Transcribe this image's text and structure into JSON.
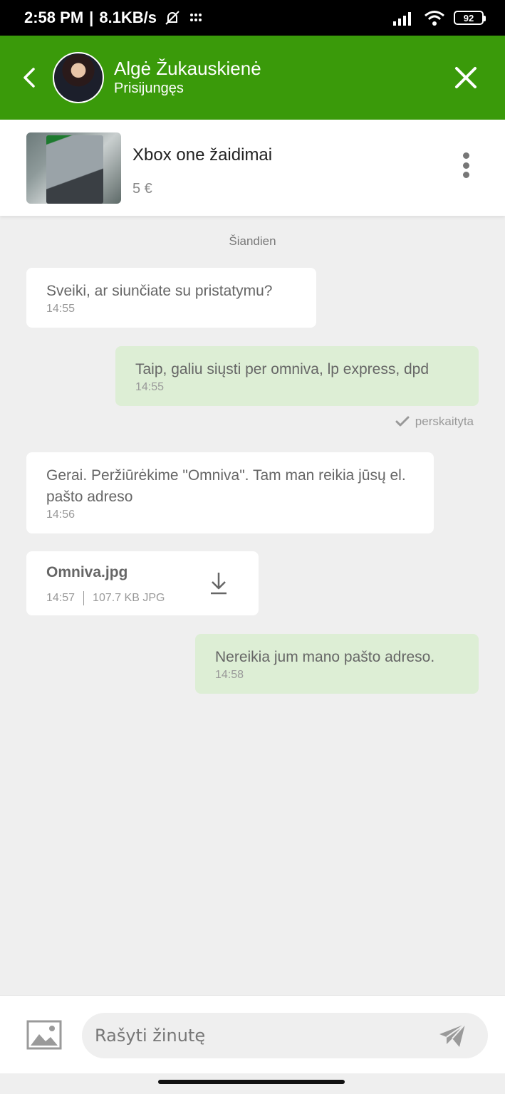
{
  "status_bar": {
    "time": "2:58 PM",
    "network_speed": "8.1KB/s",
    "battery": "92"
  },
  "header": {
    "contact_name": "Algė Žukauskienė",
    "contact_status": "Prisijungęs",
    "icons": [
      "chevron-left-icon",
      "close-icon"
    ],
    "background": "#3a9a0a"
  },
  "listing": {
    "title": "Xbox one žaidimai",
    "price": "5 €"
  },
  "chat": {
    "date_separator": "Šiandien",
    "messages": [
      {
        "direction": "in",
        "text": "Sveiki, ar siunčiate su pristatymu?",
        "time": "14:55"
      },
      {
        "direction": "out",
        "text": "Taip, galiu siųsti per omniva, lp express, dpd",
        "time": "14:55"
      },
      {
        "direction": "in",
        "text": "Gerai. Peržiūrėkime \"Omniva\". Tam man reikia jūsų el. pašto adreso",
        "time": "14:56"
      },
      {
        "direction": "in",
        "type": "file",
        "file_name": "Omniva.jpg",
        "time": "14:57",
        "file_info": "107.7 KB JPG"
      },
      {
        "direction": "out",
        "text": "Nereikia jum mano pašto adreso.",
        "time": "14:58"
      }
    ],
    "read_receipt": "perskaityta",
    "colors": {
      "incoming": "#ffffff",
      "outgoing": "#ddeed5"
    }
  },
  "composer": {
    "placeholder": "Rašyti žinutę",
    "icons": [
      "image-icon",
      "send-icon"
    ]
  }
}
